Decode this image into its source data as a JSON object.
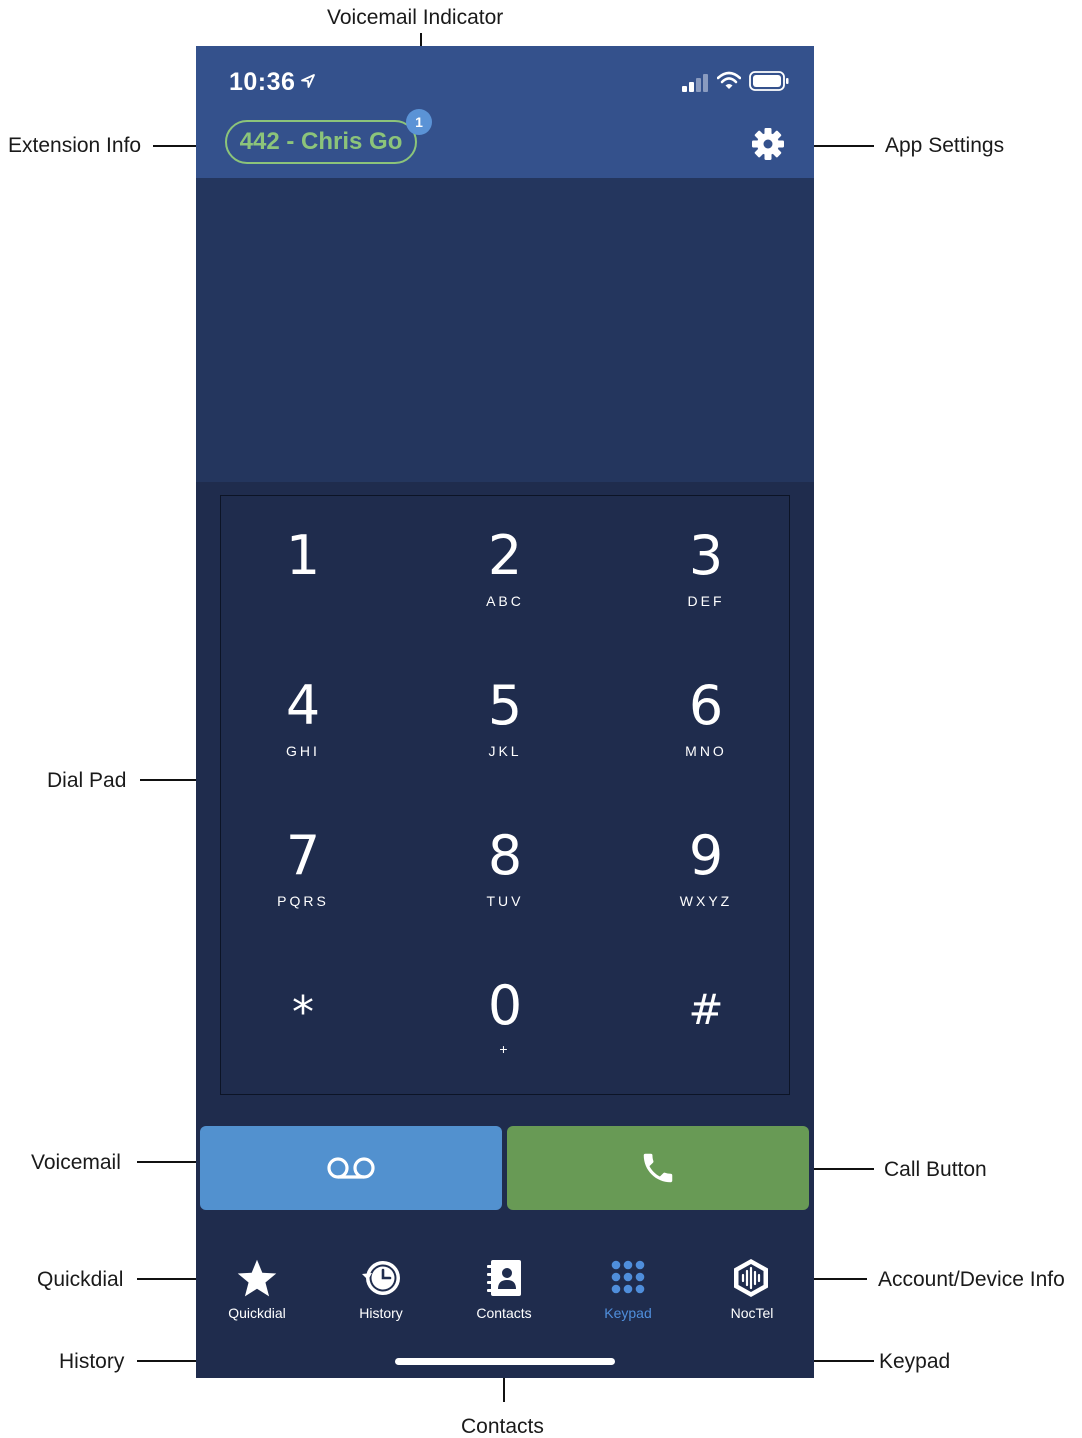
{
  "annotations": {
    "voicemail_indicator": "Voicemail Indicator",
    "extension_info": "Extension Info",
    "app_settings": "App Settings",
    "dial_pad": "Dial Pad",
    "voicemail": "Voicemail",
    "call_button": "Call Button",
    "quickdial": "Quickdial",
    "account_device_info": "Account/Device Info",
    "history": "History",
    "keypad": "Keypad",
    "contacts": "Contacts"
  },
  "status_bar": {
    "time": "10:36",
    "icons": [
      "location-arrow-icon",
      "signal-icon",
      "wifi-icon",
      "battery-icon"
    ]
  },
  "header": {
    "extension": "442 - Chris Go",
    "voicemail_count": "1",
    "settings_icon": "gear-icon"
  },
  "dialpad": {
    "keys": [
      {
        "digit": "1",
        "letters": ""
      },
      {
        "digit": "2",
        "letters": "ABC"
      },
      {
        "digit": "3",
        "letters": "DEF"
      },
      {
        "digit": "4",
        "letters": "GHI"
      },
      {
        "digit": "5",
        "letters": "JKL"
      },
      {
        "digit": "6",
        "letters": "MNO"
      },
      {
        "digit": "7",
        "letters": "PQRS"
      },
      {
        "digit": "8",
        "letters": "TUV"
      },
      {
        "digit": "9",
        "letters": "WXYZ"
      },
      {
        "digit": "*",
        "letters": ""
      },
      {
        "digit": "0",
        "letters": "+"
      },
      {
        "digit": "#",
        "letters": ""
      }
    ]
  },
  "actions": {
    "voicemail_icon": "voicemail-icon",
    "call_icon": "phone-icon"
  },
  "tabs": [
    {
      "label": "Quickdial",
      "icon": "star-icon",
      "active": false
    },
    {
      "label": "History",
      "icon": "clock-history-icon",
      "active": false
    },
    {
      "label": "Contacts",
      "icon": "contacts-book-icon",
      "active": false
    },
    {
      "label": "Keypad",
      "icon": "keypad-grid-icon",
      "active": true
    },
    {
      "label": "NocTel",
      "icon": "noctel-logo-icon",
      "active": false
    }
  ],
  "colors": {
    "header": "#34518c",
    "display": "#24365e",
    "background": "#1f2c4d",
    "extension_green": "#8cc47a",
    "voicemail_button": "#5291cf",
    "call_button": "#689a55",
    "active_tab": "#4f8edb"
  }
}
